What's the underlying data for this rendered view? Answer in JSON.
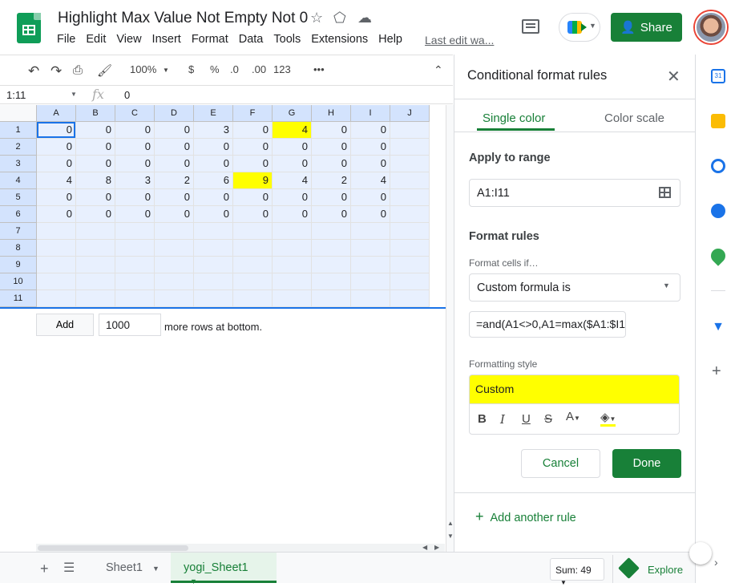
{
  "doc": {
    "title": "Highlight Max Value Not Empty Not 0",
    "last_edit": "Last edit wa..."
  },
  "menu": [
    "File",
    "Edit",
    "View",
    "Insert",
    "Format",
    "Data",
    "Tools",
    "Extensions",
    "Help"
  ],
  "share_label": "Share",
  "toolbar": {
    "zoom": "100%",
    "currency": "$",
    "percent": "%",
    "dec_less": ".0",
    "dec_more": ".00",
    "number_format": "123",
    "more": "•••"
  },
  "formula_bar": {
    "name_box": "1:11",
    "fx": "fx",
    "value": "0"
  },
  "grid": {
    "columns": [
      "A",
      "B",
      "C",
      "D",
      "E",
      "F",
      "G",
      "H",
      "I",
      "J"
    ],
    "row_numbers": [
      "1",
      "2",
      "3",
      "4",
      "5",
      "6",
      "7",
      "8",
      "9",
      "10",
      "11"
    ],
    "rows": [
      [
        "0",
        "0",
        "0",
        "0",
        "3",
        "0",
        "4",
        "0",
        "0",
        ""
      ],
      [
        "0",
        "0",
        "0",
        "0",
        "0",
        "0",
        "0",
        "0",
        "0",
        ""
      ],
      [
        "0",
        "0",
        "0",
        "0",
        "0",
        "0",
        "0",
        "0",
        "0",
        ""
      ],
      [
        "4",
        "8",
        "3",
        "2",
        "6",
        "9",
        "4",
        "2",
        "4",
        ""
      ],
      [
        "0",
        "0",
        "0",
        "0",
        "0",
        "0",
        "0",
        "0",
        "0",
        ""
      ],
      [
        "0",
        "0",
        "0",
        "0",
        "0",
        "0",
        "0",
        "0",
        "0",
        ""
      ],
      [
        "",
        "",
        "",
        "",
        "",
        "",
        "",
        "",
        "",
        ""
      ],
      [
        "",
        "",
        "",
        "",
        "",
        "",
        "",
        "",
        "",
        ""
      ],
      [
        "",
        "",
        "",
        "",
        "",
        "",
        "",
        "",
        "",
        ""
      ],
      [
        "",
        "",
        "",
        "",
        "",
        "",
        "",
        "",
        "",
        ""
      ],
      [
        "",
        "",
        "",
        "",
        "",
        "",
        "",
        "",
        "",
        ""
      ]
    ],
    "highlight_color": "#ffff00",
    "selection_color": "#e8f0fe"
  },
  "add_rows": {
    "button": "Add",
    "count": "1000",
    "label": "more rows at bottom."
  },
  "sheets": {
    "tabs": [
      "Sheet1",
      "yogi_Sheet1"
    ],
    "active": "yogi_Sheet1",
    "sum": "Sum: 49",
    "explore": "Explore"
  },
  "panel": {
    "title": "Conditional format rules",
    "tabs": [
      "Single color",
      "Color scale"
    ],
    "apply_label": "Apply to range",
    "range": "A1:I11",
    "rules_label": "Format rules",
    "format_if_label": "Format cells if…",
    "condition": "Custom formula is",
    "formula": "=and(A1<>0,A1=max($A1:$I1",
    "style_label": "Formatting style",
    "style_preview": "Custom",
    "style_color": "#ffff00",
    "cancel": "Cancel",
    "done": "Done",
    "add_rule": "Add another rule"
  },
  "accent": "#188038"
}
